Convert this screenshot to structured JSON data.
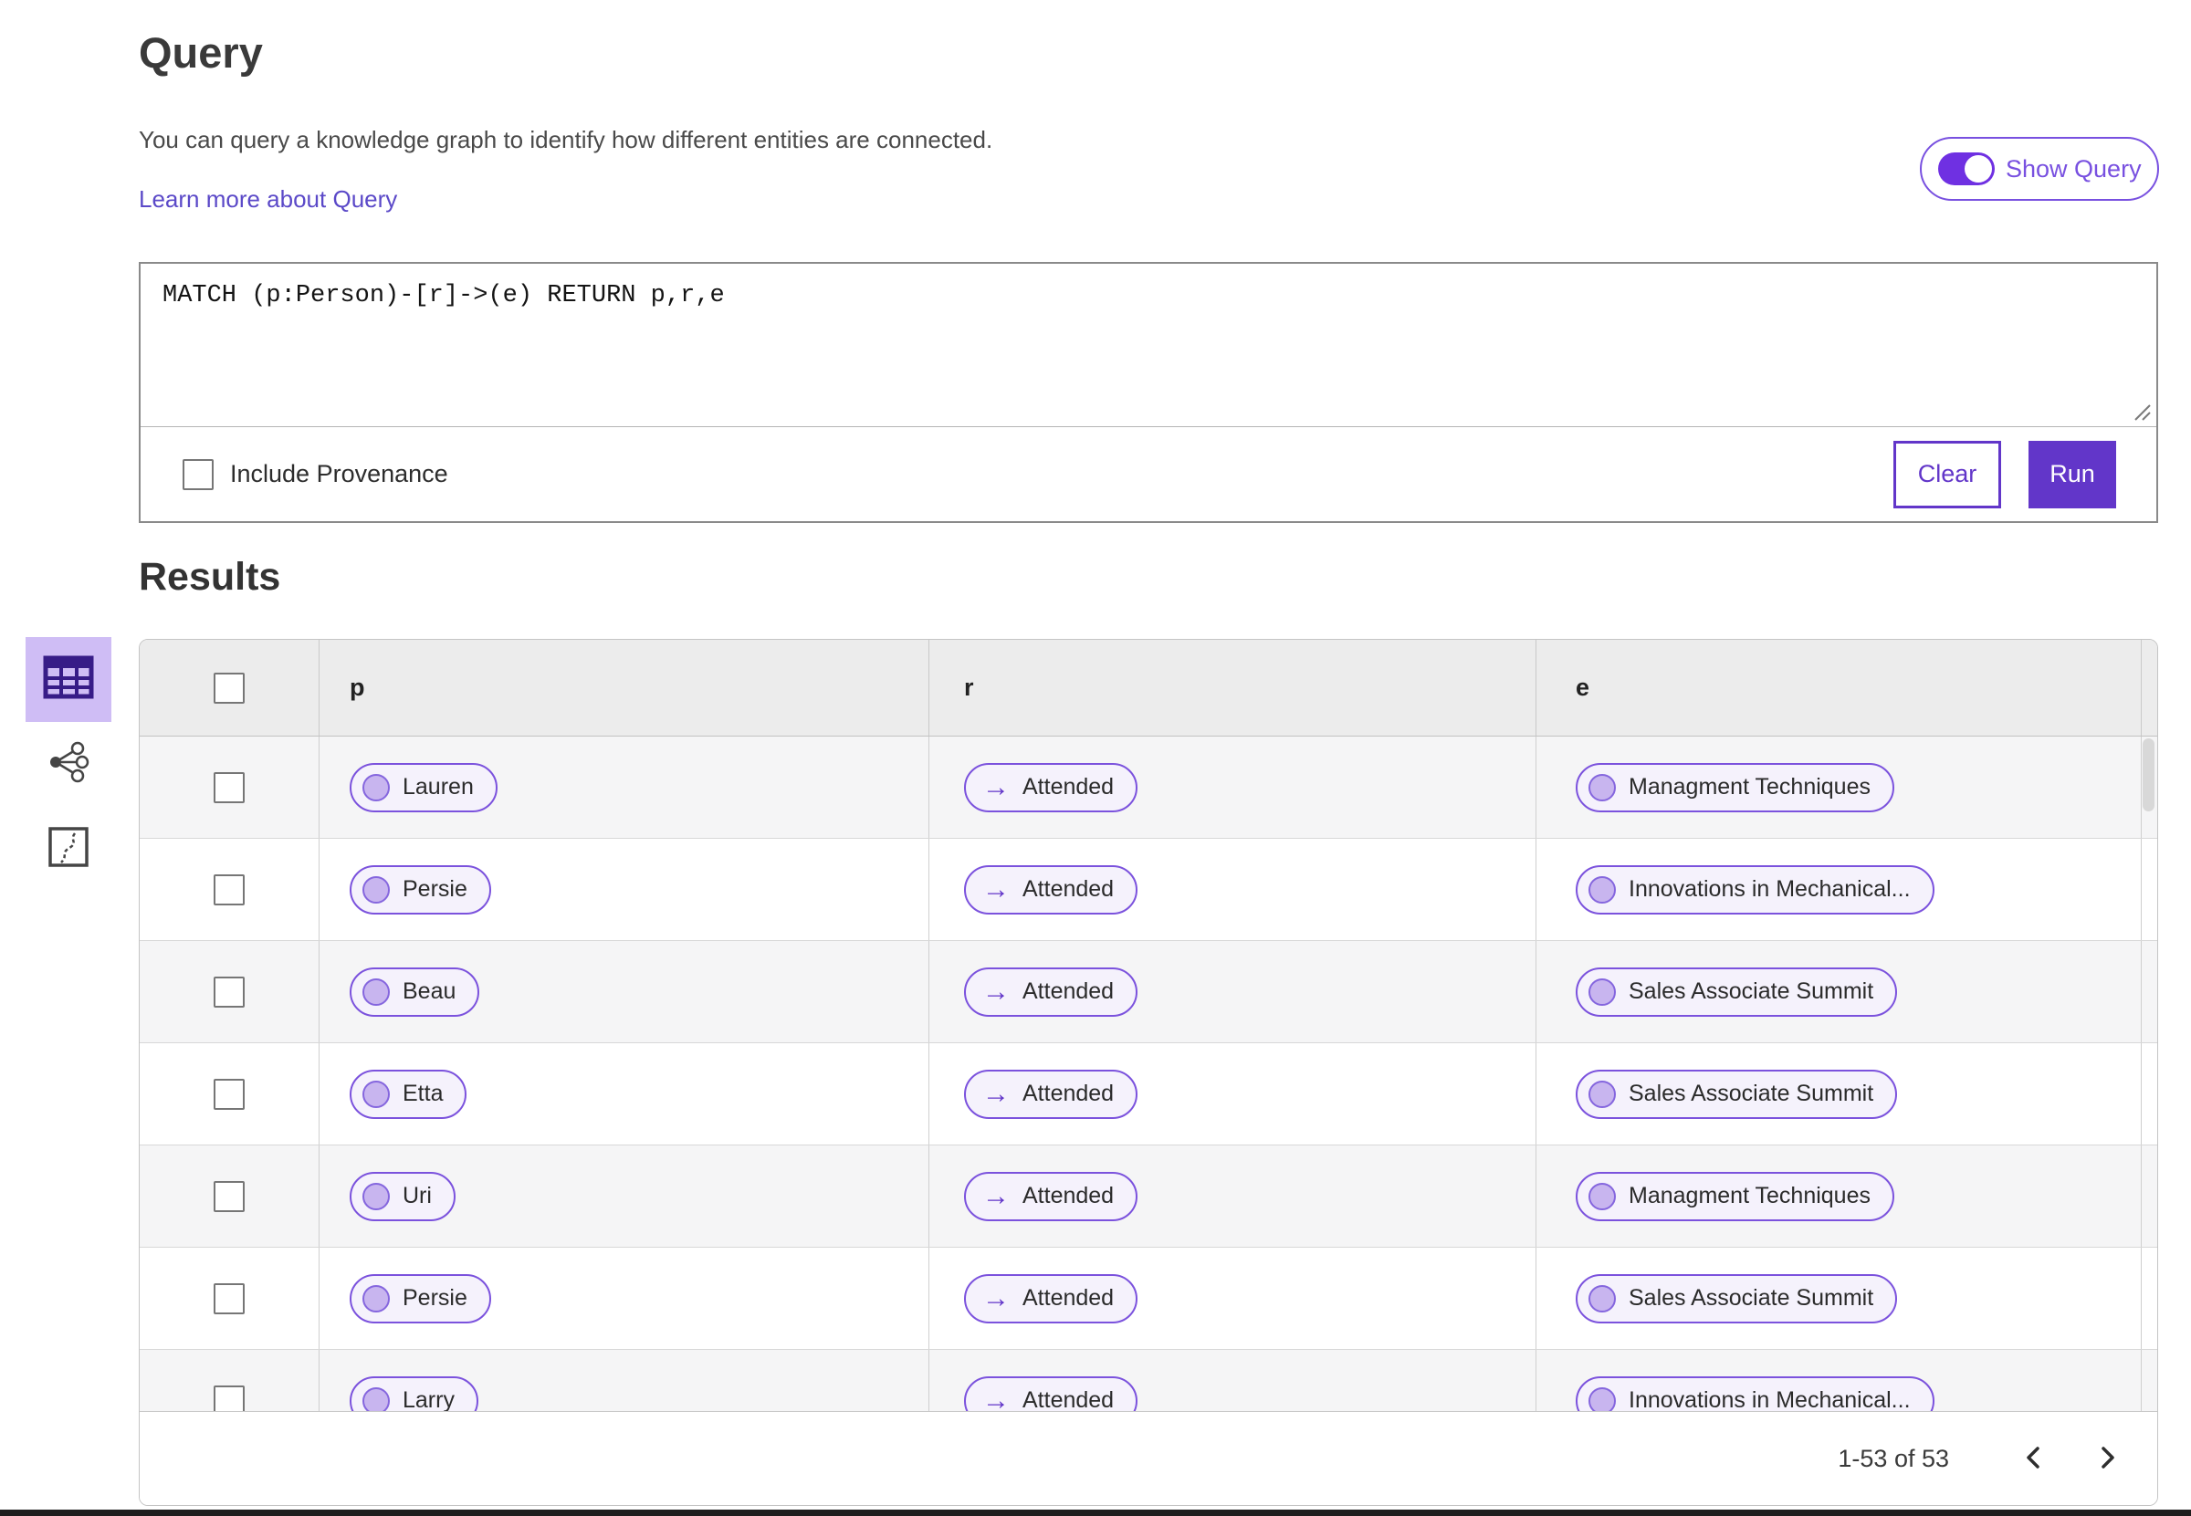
{
  "colors": {
    "accent": "#6236c9",
    "toggle_track": "#6f30e2",
    "toggle_outline": "#7850e0",
    "link": "#5b49c8",
    "chip_border": "#7b52dd",
    "chip_background": "#f5f2fc",
    "node_circle_fill": "#c8b5ef",
    "selected_view_background": "#cfbdf5",
    "table_header_background": "#ececec",
    "row_stripe": "#f5f5f6"
  },
  "query_section": {
    "title": "Query",
    "description": "You can query a knowledge graph to identify how different entities are connected.",
    "learn_more_link": "Learn more about Query",
    "show_query_label": "Show Query",
    "show_query_on": true,
    "query_text": "MATCH (p:Person)-[r]->(e) RETURN p,r,e",
    "include_provenance_label": "Include Provenance",
    "include_provenance_checked": false,
    "clear_label": "Clear",
    "run_label": "Run"
  },
  "results_section": {
    "title": "Results",
    "view_icons": [
      "table-view-icon",
      "network-view-icon",
      "map-view-icon"
    ],
    "selected_view": "table-view-icon",
    "table": {
      "columns": [
        "p",
        "r",
        "e"
      ],
      "rows": [
        {
          "p": "Lauren",
          "r": "Attended",
          "e": "Managment Techniques"
        },
        {
          "p": "Persie",
          "r": "Attended",
          "e": "Innovations in Mechanical..."
        },
        {
          "p": "Beau",
          "r": "Attended",
          "e": "Sales Associate Summit"
        },
        {
          "p": "Etta",
          "r": "Attended",
          "e": "Sales Associate Summit"
        },
        {
          "p": "Uri",
          "r": "Attended",
          "e": "Managment Techniques"
        },
        {
          "p": "Persie",
          "r": "Attended",
          "e": "Sales Associate Summit"
        },
        {
          "p": "Larry",
          "r": "Attended",
          "e": "Innovations in Mechanical..."
        }
      ]
    },
    "pagination": {
      "range_label": "1-53 of 53"
    }
  },
  "icons": {
    "relationship_arrow_glyph": "→",
    "chevron_left": "chevron-left-icon",
    "chevron_right": "chevron-right-icon",
    "resize_handle": "resize-handle-icon"
  }
}
